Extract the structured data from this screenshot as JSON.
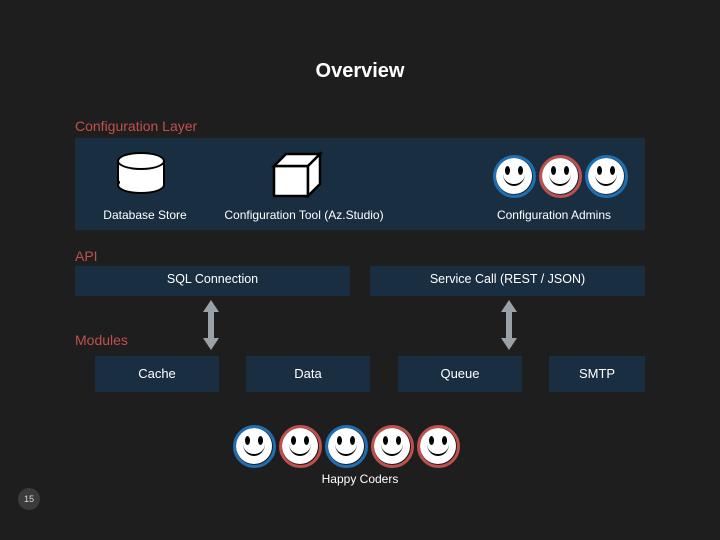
{
  "title": "Overview",
  "sections": {
    "config_layer": "Configuration Layer",
    "api": "API",
    "modules": "Modules"
  },
  "config_layer": {
    "database_store": "Database Store",
    "config_tool": "Configuration Tool (Az.Studio)",
    "config_admins": "Configuration Admins"
  },
  "api": {
    "sql_connection": "SQL Connection",
    "service_call": "Service Call (REST / JSON)"
  },
  "modules": {
    "cache": "Cache",
    "data": "Data",
    "queue": "Queue",
    "smtp": "SMTP"
  },
  "happy_coders": "Happy Coders",
  "slide_number": "15",
  "colors": {
    "panel": "#1a2e41",
    "accent_red": "#c0504d",
    "accent_blue": "#1f6fb5",
    "background": "#1e1e1e"
  }
}
